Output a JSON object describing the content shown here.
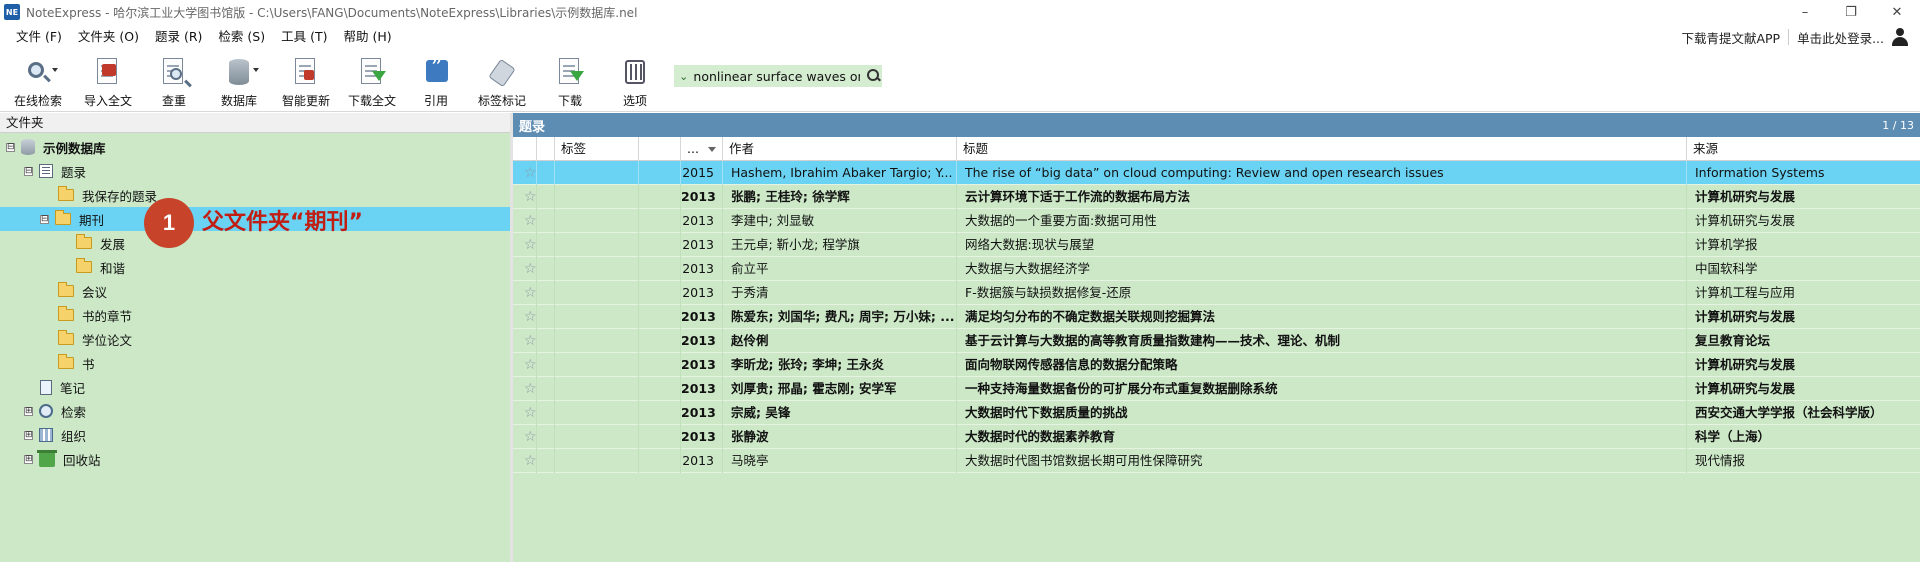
{
  "window": {
    "app_icon_text": "NE",
    "title": "NoteExpress - 哈尔滨工业大学图书馆版 - C:\\Users\\FANG\\Documents\\NoteExpress\\Libraries\\示例数据库.nel",
    "controls": [
      "–",
      "❐",
      "✕"
    ]
  },
  "menu": {
    "items": [
      "文件 (F)",
      "文件夹 (O)",
      "题录 (R)",
      "检索 (S)",
      "工具 (T)",
      "帮助 (H)"
    ],
    "right_link": "下载青提文献APP",
    "login": "单击此处登录..."
  },
  "toolbar": {
    "buttons": [
      {
        "label": "在线检索",
        "icon": "online-search-icon"
      },
      {
        "label": "导入全文",
        "icon": "import-fulltext-icon"
      },
      {
        "label": "查重",
        "icon": "duplicate-check-icon"
      },
      {
        "label": "数据库",
        "icon": "database-icon"
      },
      {
        "label": "智能更新",
        "icon": "smart-update-icon"
      },
      {
        "label": "下载全文",
        "icon": "download-fulltext-icon"
      },
      {
        "label": "引用",
        "icon": "cite-icon"
      },
      {
        "label": "标签标记",
        "icon": "tag-mark-icon"
      },
      {
        "label": "下载",
        "icon": "download-icon"
      },
      {
        "label": "选项",
        "icon": "options-icon"
      }
    ],
    "search_query": "nonlinear surface waves on"
  },
  "folders": {
    "header": "文件夹",
    "tree": [
      {
        "label": "示例数据库",
        "expander": "⊟",
        "icon": "database"
      },
      {
        "label": "题录",
        "expander": "⊟",
        "icon": "list"
      },
      {
        "label": "我保存的题录",
        "icon": "folder"
      },
      {
        "label": "期刊",
        "expander": "⊟",
        "icon": "folder",
        "selected": true
      },
      {
        "label": "发展",
        "icon": "folder"
      },
      {
        "label": "和谐",
        "icon": "folder"
      },
      {
        "label": "会议",
        "icon": "folder"
      },
      {
        "label": "书的章节",
        "icon": "folder"
      },
      {
        "label": "学位论文",
        "icon": "folder"
      },
      {
        "label": "书",
        "icon": "folder"
      },
      {
        "label": "笔记",
        "icon": "note"
      },
      {
        "label": "检索",
        "expander": "⊞",
        "icon": "search"
      },
      {
        "label": "组织",
        "expander": "⊞",
        "icon": "org"
      },
      {
        "label": "回收站",
        "expander": "⊞",
        "icon": "bin"
      }
    ]
  },
  "callout": {
    "number": "1",
    "text": "父文件夹“期刊”"
  },
  "records": {
    "title": "题录",
    "page": "1 / 13",
    "columns": {
      "tag": "标签",
      "year": "...",
      "author": "作者",
      "title": "标题",
      "source": "来源"
    },
    "rows": [
      {
        "year": "2015",
        "author": "Hashem, Ibrahim Abaker Targio; Y...",
        "title": "The rise of  “big data”  on cloud computing: Review and open research issues",
        "source": "Information Systems",
        "bold": false,
        "selected": true
      },
      {
        "year": "2013",
        "author": "张鹏; 王桂玲; 徐学辉",
        "title": "云计算环境下适于工作流的数据布局方法",
        "source": "计算机研究与发展",
        "bold": true
      },
      {
        "year": "2013",
        "author": "李建中; 刘显敏",
        "title": "大数据的一个重要方面:数据可用性",
        "source": "计算机研究与发展",
        "bold": false
      },
      {
        "year": "2013",
        "author": "王元卓; 靳小龙; 程学旗",
        "title": "网络大数据:现状与展望",
        "source": "计算机学报",
        "bold": false
      },
      {
        "year": "2013",
        "author": "俞立平",
        "title": "大数据与大数据经济学",
        "source": "中国软科学",
        "bold": false
      },
      {
        "year": "2013",
        "author": "于秀清",
        "title": "F-数据簇与缺损数据修复-还原",
        "source": "计算机工程与应用",
        "bold": false
      },
      {
        "year": "2013",
        "author": "陈爱东; 刘国华; 费凡; 周宇; 万小妹; ...",
        "title": "满足均匀分布的不确定数据关联规则挖掘算法",
        "source": "计算机研究与发展",
        "bold": true
      },
      {
        "year": "2013",
        "author": "赵伶俐",
        "title": "基于云计算与大数据的高等教育质量指数建构——技术、理论、机制",
        "source": "复旦教育论坛",
        "bold": true
      },
      {
        "year": "2013",
        "author": "李昕龙; 张玲; 李坤; 王永炎",
        "title": "面向物联网传感器信息的数据分配策略",
        "source": "计算机研究与发展",
        "bold": true
      },
      {
        "year": "2013",
        "author": "刘厚贵; 邢晶; 霍志刚; 安学军",
        "title": "一种支持海量数据备份的可扩展分布式重复数据删除系统",
        "source": "计算机研究与发展",
        "bold": true
      },
      {
        "year": "2013",
        "author": "宗威; 吴锋",
        "title": "大数据时代下数据质量的挑战",
        "source": "西安交通大学学报（社会科学版）",
        "bold": true
      },
      {
        "year": "2013",
        "author": "张静波",
        "title": "大数据时代的数据素养教育",
        "source": "科学（上海）",
        "bold": true
      },
      {
        "year": "2013",
        "author": "马晓亭",
        "title": "大数据时代图书馆数据长期可用性保障研究",
        "source": "现代情报",
        "bold": false
      }
    ]
  }
}
